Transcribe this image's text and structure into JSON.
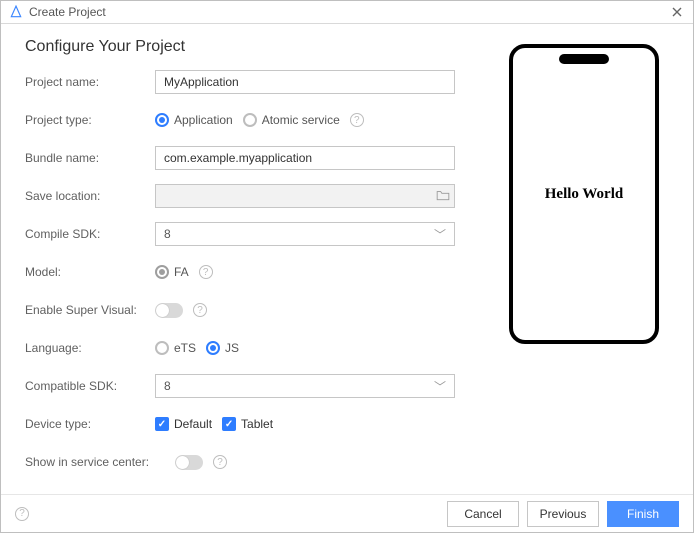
{
  "window": {
    "title": "Create Project"
  },
  "heading": "Configure Your Project",
  "labels": {
    "project_name": "Project name:",
    "project_type": "Project type:",
    "bundle_name": "Bundle name:",
    "save_location": "Save location:",
    "compile_sdk": "Compile SDK:",
    "model": "Model:",
    "enable_super_visual": "Enable Super Visual:",
    "language": "Language:",
    "compatible_sdk": "Compatible SDK:",
    "device_type": "Device type:",
    "show_in_service_center": "Show in service center:"
  },
  "values": {
    "project_name": "MyApplication",
    "bundle_name": "com.example.myapplication",
    "compile_sdk": "8",
    "compatible_sdk": "8"
  },
  "project_type": {
    "application": "Application",
    "atomic_service": "Atomic service",
    "selected": "application"
  },
  "model": {
    "fa": "FA",
    "selected": "fa"
  },
  "super_visual": {
    "enabled": false
  },
  "language": {
    "ets": "eTS",
    "js": "JS",
    "selected": "js"
  },
  "device_type": {
    "default": "Default",
    "tablet": "Tablet",
    "default_checked": true,
    "tablet_checked": true
  },
  "service_center": {
    "enabled": false
  },
  "preview": {
    "text": "Hello World"
  },
  "buttons": {
    "cancel": "Cancel",
    "previous": "Previous",
    "finish": "Finish"
  }
}
